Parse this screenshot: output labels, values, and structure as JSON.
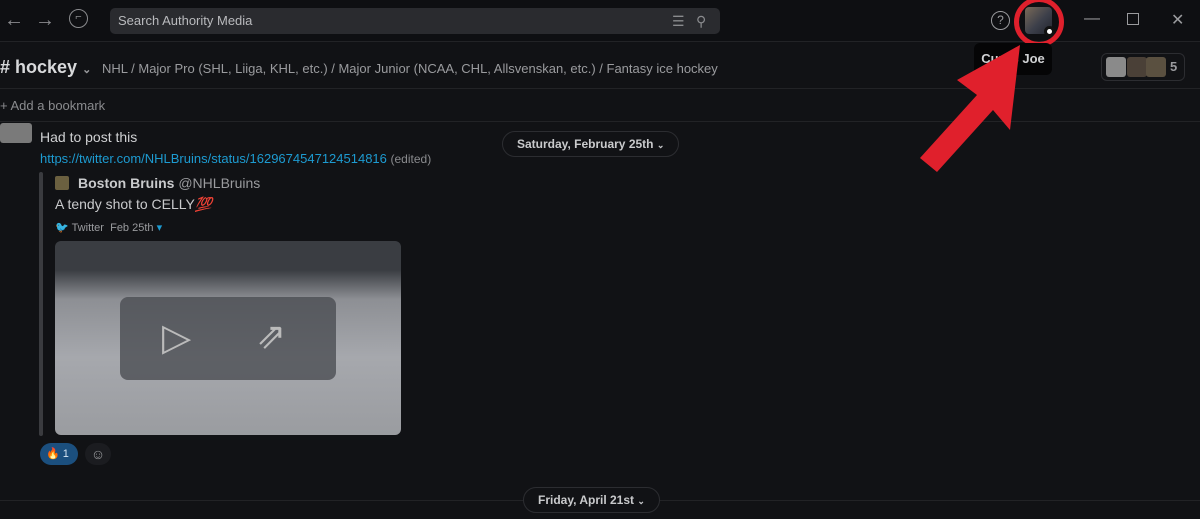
{
  "titlebar": {
    "search_placeholder": "Search Authority Media",
    "back_icon": "arrow-left",
    "forward_icon": "arrow-right",
    "history_icon": "clock",
    "help_label": "?"
  },
  "header": {
    "channel": "# hockey",
    "topic": "NHL / Major Pro (SHL, Liiga, KHL, etc.) / Major Junior (NCAA, CHL, Allsvenskan, etc.) / Fantasy ice hockey",
    "member_count": "5"
  },
  "tooltip": {
    "text": "Curtis Joe"
  },
  "bookmark": {
    "label": "Add a bookmark"
  },
  "dates": {
    "first": "Saturday, February 25th",
    "second": "Friday, April 21st"
  },
  "message": {
    "text": "Had to post this",
    "link": "https://twitter.com/NHLBruins/status/1629674547124514816",
    "edited": "(edited)",
    "embed": {
      "author": "Boston Bruins",
      "handle": "@NHLBruins",
      "text": "A tendy shot to CELLY",
      "emoji": "💯",
      "source": "Twitter",
      "date": "Feb 25th"
    },
    "reaction": {
      "emoji": "🔥",
      "count": "1"
    }
  },
  "colors": {
    "accent_red": "#e0202c",
    "link": "#1d9bd1",
    "reaction_bg": "#1b4f7e"
  }
}
